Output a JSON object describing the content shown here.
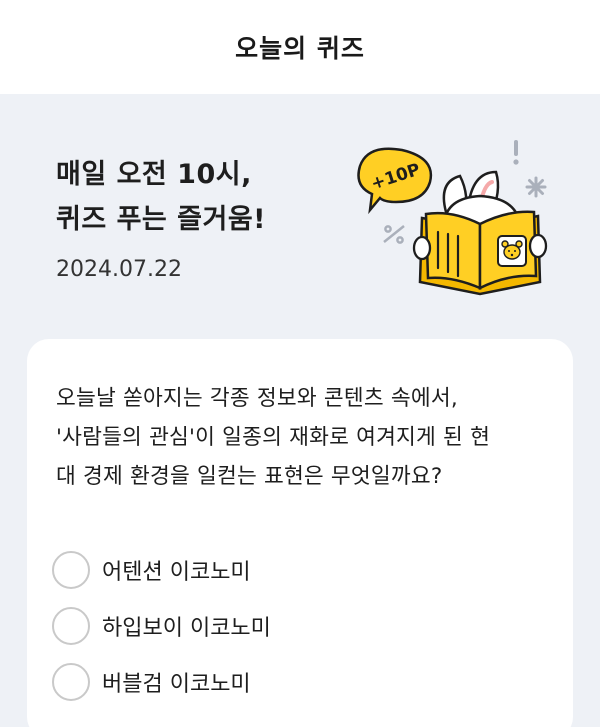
{
  "header": {
    "title": "오늘의 퀴즈"
  },
  "hero": {
    "title_line1": "매일 오전 10시,",
    "title_line2": "퀴즈 푸는 즐거움!",
    "date": "2024.07.22",
    "badge": "+10P",
    "accent_yellow": "#ffcf24",
    "background": "#eef1f6"
  },
  "quiz": {
    "question_line1": "오늘날 쏟아지는 각종 정보와 콘텐츠 속에서,",
    "question_line2": "'사람들의 관심'이 일종의 재화로 여겨지게 된 현",
    "question_line3": "대 경제 환경을 일컫는 표현은 무엇일까요?",
    "options": [
      {
        "label": "어텐션 이코노미"
      },
      {
        "label": "하입보이 이코노미"
      },
      {
        "label": "버블검 이코노미"
      }
    ]
  }
}
